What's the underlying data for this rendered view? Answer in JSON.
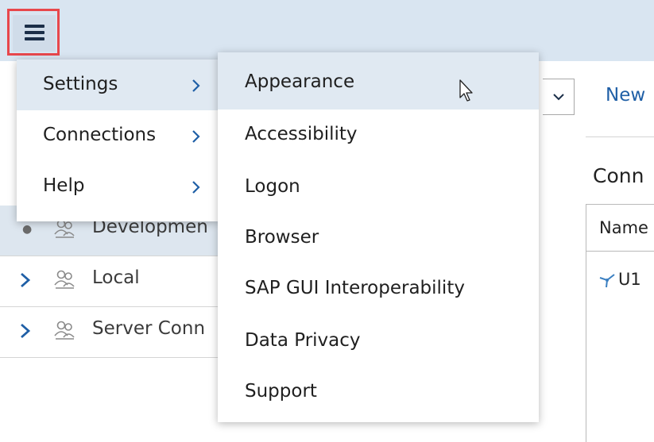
{
  "toolbar": {
    "menu_button_icon": "hamburger-icon",
    "new_link": "New"
  },
  "tree": {
    "items": [
      {
        "label": "Developmen",
        "icon": "group-icon",
        "selected": true,
        "expander": "bullet"
      },
      {
        "label": "Local",
        "icon": "group-icon",
        "selected": false,
        "expander": "chevron-right"
      },
      {
        "label": "Server Conn",
        "icon": "group-icon",
        "selected": false,
        "expander": "chevron-right"
      }
    ]
  },
  "right_panel": {
    "title": "Conn",
    "column_header": "Name",
    "rows": [
      {
        "name": "U1",
        "icon": "connection-icon"
      }
    ]
  },
  "main_menu": {
    "items": [
      {
        "label": "Settings",
        "active": true
      },
      {
        "label": "Connections",
        "active": false
      },
      {
        "label": "Help",
        "active": false
      }
    ]
  },
  "settings_submenu": {
    "items": [
      {
        "label": "Appearance",
        "active": true
      },
      {
        "label": "Accessibility",
        "active": false
      },
      {
        "label": "Logon",
        "active": false
      },
      {
        "label": "Browser",
        "active": false
      },
      {
        "label": "SAP GUI Interoperability",
        "active": false
      },
      {
        "label": "Data Privacy",
        "active": false
      },
      {
        "label": "Support",
        "active": false
      }
    ]
  },
  "colors": {
    "topbar_bg": "#d9e5f1",
    "highlight_frame": "#e8474c",
    "hover_bg": "#e0e9f2",
    "link_blue": "#1f5fa6"
  }
}
